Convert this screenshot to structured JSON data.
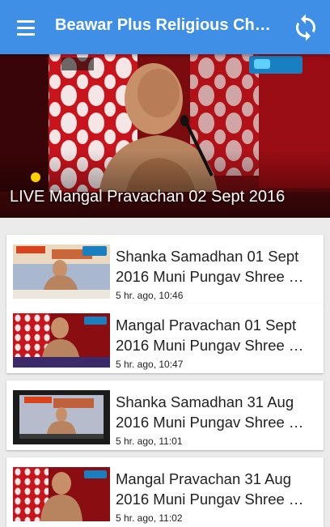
{
  "app_bar": {
    "title": "Beawar Plus Religious Ch…",
    "menu_icon": "hamburger-menu-icon",
    "refresh_icon": "refresh-icon",
    "background": "#3f8fe6"
  },
  "hero": {
    "title": "LIVE Mangal Pravachan 02 Sept 2016",
    "live_badge": "LIVE"
  },
  "videos": [
    {
      "title": "Shanka Samadhan 01 Sept 2016 Muni Pungav Shree …",
      "meta": "5 hr. ago, 10:46"
    },
    {
      "title": "Mangal Pravachan 01 Sept 2016 Muni Pungav Shree …",
      "meta": "5 hr. ago, 10:47"
    },
    {
      "title": "Shanka Samadhan 31 Aug 2016 Muni Pungav Shree …",
      "meta": "5 hr. ago, 11:01"
    },
    {
      "title": "Mangal Pravachan 31 Aug 2016 Muni Pungav Shree …",
      "meta": "5 hr. ago, 11:02"
    }
  ]
}
